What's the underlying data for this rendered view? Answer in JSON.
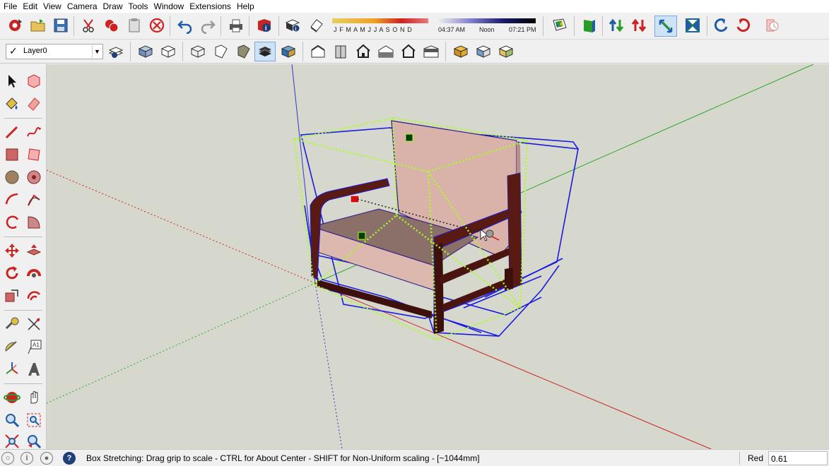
{
  "menu": [
    "File",
    "Edit",
    "View",
    "Camera",
    "Draw",
    "Tools",
    "Window",
    "Extensions",
    "Help"
  ],
  "layer": {
    "name": "Layer0",
    "checkmark": "✓"
  },
  "shadow": {
    "months": "J F M A M J J A S O N D",
    "time_start": "04:37 AM",
    "time_mid": "Noon",
    "time_end": "07:21 PM"
  },
  "toolbar_icons": [
    "get-started-icon",
    "open-icon",
    "save-icon",
    "cut-icon",
    "copy-icon",
    "paste-icon",
    "erase-icon",
    "undo-icon",
    "redo-icon",
    "print-icon",
    "model-info-icon",
    "shadows-toggle-icon",
    "fog-toggle-icon",
    "standard-view-icon",
    "scale-icon",
    "flip-along-icon",
    "scale-tool-icon",
    "rotate-icon",
    "orbit-icon",
    "warehouse-icon"
  ],
  "style_icons": [
    "xray-icon",
    "back-edges-icon",
    "wireframe-icon",
    "hidden-line-icon",
    "shaded-icon",
    "shaded-textures-icon",
    "monochrome-icon"
  ],
  "view_icons": [
    "iso-view-icon",
    "top-view-icon",
    "front-view-icon",
    "right-view-icon",
    "back-view-icon",
    "left-view-icon"
  ],
  "component_icons": [
    "components-icon",
    "materials-icon",
    "styles-icon"
  ],
  "status": {
    "message": "Box Stretching: Drag grip to scale - CTRL for About Center - SHIFT for Non-Uniform scaling - [~1044mm]",
    "measure_label": "Red",
    "measure_value": "0.61"
  },
  "colors": {
    "axis_red": "#cc2222",
    "axis_green": "#2aa82a",
    "axis_blue": "#3333cc",
    "selection_blue": "#1a1ae0",
    "grip_green": "#a8ff20",
    "cushion": "#d9b3aa",
    "wood": "#5a1a14",
    "sky": "#d6d8ce"
  }
}
